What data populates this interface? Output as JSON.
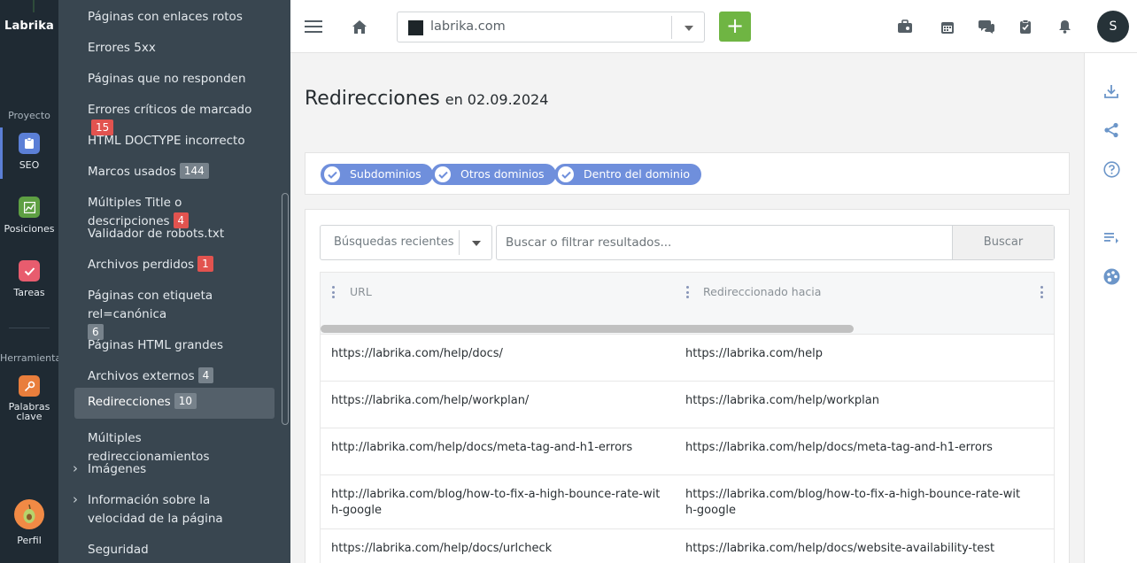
{
  "brand": "Labrika",
  "rail": {
    "project_label": "Proyecto",
    "tools_label": "Herramientas",
    "items": [
      {
        "label": "SEO",
        "color": "#5b7fd6"
      },
      {
        "label": "Posiciones",
        "color": "#5ea043"
      },
      {
        "label": "Tareas",
        "color": "#e85c6e"
      },
      {
        "label": "Palabras clave",
        "color": "#e97e3c"
      }
    ],
    "profile_label": "Perfil"
  },
  "subnav": {
    "items": [
      {
        "label": "Páginas con enlaces rotos"
      },
      {
        "label": "Errores 5xx"
      },
      {
        "label": "Páginas que no responden"
      },
      {
        "label": "Errores críticos de marcado",
        "badge": "15",
        "badge_color": "red"
      },
      {
        "label": "HTML DOCTYPE incorrecto"
      },
      {
        "label": "Marcos usados",
        "badge": "144",
        "badge_color": "gray"
      },
      {
        "label": "Múltiples Title o descripciones",
        "badge": "4",
        "badge_color": "red"
      },
      {
        "label": "Validador de robots.txt"
      },
      {
        "label": "Archivos perdidos",
        "badge": "1",
        "badge_color": "red"
      },
      {
        "label": "Páginas con etiqueta rel=canónica",
        "badge": "6",
        "badge_color": "gray"
      },
      {
        "label": "Páginas HTML grandes"
      },
      {
        "label": "Archivos externos",
        "badge": "4",
        "badge_color": "gray"
      },
      {
        "label": "Redirecciones",
        "badge": "10",
        "badge_color": "gray",
        "active": true
      },
      {
        "label": "Múltiples redireccionamientos"
      },
      {
        "label": "Imágenes",
        "expandable": true
      },
      {
        "label": "Información sobre la velocidad de la página",
        "expandable": true
      },
      {
        "label": "Seguridad"
      }
    ]
  },
  "topbar": {
    "domain": "labrika.com",
    "add_label": "+",
    "user_initial": "S"
  },
  "page": {
    "title": "Redirecciones",
    "date": "en 02.09.2024"
  },
  "filters": [
    {
      "label": "Subdominios"
    },
    {
      "label": "Otros dominios"
    },
    {
      "label": "Dentro del dominio"
    }
  ],
  "search": {
    "recent_label": "Búsquedas recientes",
    "placeholder": "Buscar o filtrar resultados...",
    "button": "Buscar"
  },
  "table": {
    "columns": [
      "URL",
      "Redireccionado hacia"
    ],
    "rows": [
      [
        "https://labrika.com/help/docs/",
        "https://labrika.com/help"
      ],
      [
        "https://labrika.com/help/workplan/",
        "https://labrika.com/help/workplan"
      ],
      [
        "http://labrika.com/help/docs/meta-tag-and-h1-errors",
        "https://labrika.com/help/docs/meta-tag-and-h1-errors"
      ],
      [
        "http://labrika.com/blog/how-to-fix-a-high-bounce-rate-with-google",
        "https://labrika.com/blog/how-to-fix-a-high-bounce-rate-with-google"
      ],
      [
        "https://labrika.com/help/docs/urlcheck",
        "https://labrika.com/help/docs/website-availability-test"
      ]
    ]
  }
}
